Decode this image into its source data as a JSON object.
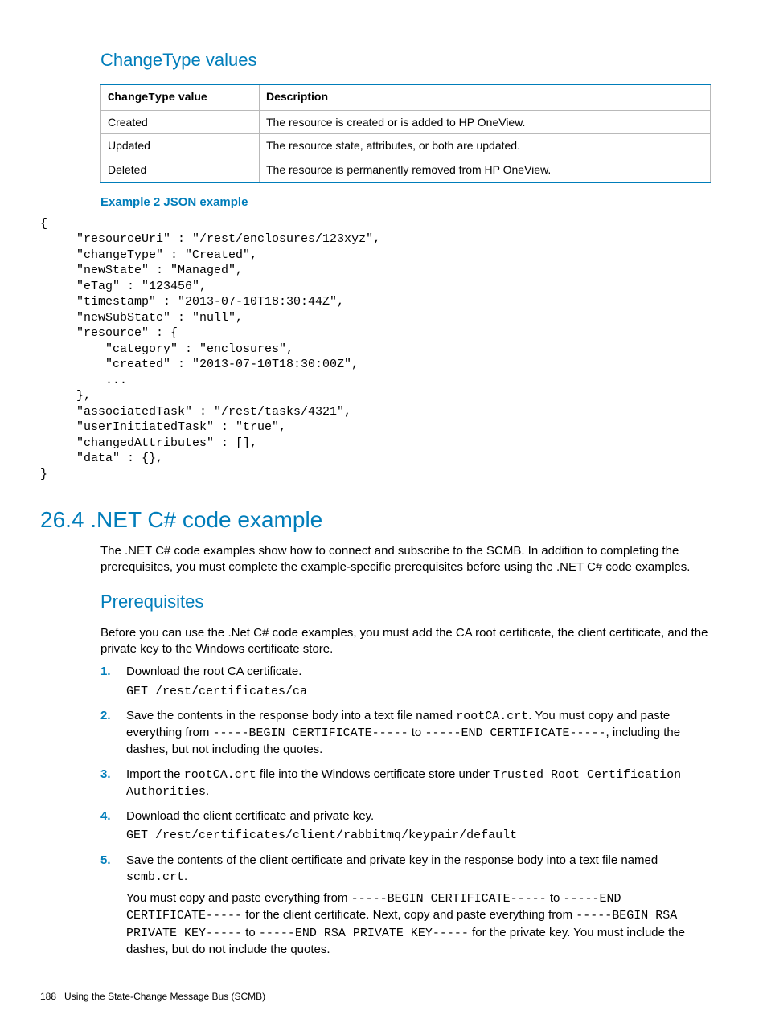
{
  "headings": {
    "changetype": "ChangeType values",
    "net_example": "26.4 .NET C# code example",
    "prerequisites": "Prerequisites",
    "example_label": "Example 2 JSON example"
  },
  "table": {
    "header_col1_mono": "ChangeType",
    "header_col1_rest": " value",
    "header_col2": "Description",
    "rows": [
      {
        "value": "Created",
        "desc": "The resource is created or is added to HP OneView."
      },
      {
        "value": "Updated",
        "desc": "The resource state, attributes, or both are updated."
      },
      {
        "value": "Deleted",
        "desc": "The resource is permanently removed from HP OneView."
      }
    ]
  },
  "json_code": "{\n     \"resourceUri\" : \"/rest/enclosures/123xyz\",\n     \"changeType\" : \"Created\",\n     \"newState\" : \"Managed\",\n     \"eTag\" : \"123456\",\n     \"timestamp\" : \"2013-07-10T18:30:44Z\",\n     \"newSubState\" : \"null\",\n     \"resource\" : {\n         \"category\" : \"enclosures\",\n         \"created\" : \"2013-07-10T18:30:00Z\",\n         ...\n     },\n     \"associatedTask\" : \"/rest/tasks/4321\",\n     \"userInitiatedTask\" : \"true\",\n     \"changedAttributes\" : [],\n     \"data\" : {},\n}",
  "net_intro": "The .NET C# code examples show how to connect and subscribe to the SCMB. In addition to completing the prerequisites, you must complete the example-specific prerequisites before using the .NET C# code examples.",
  "prereq_intro": "Before you can use the .Net C# code examples, you must add the CA root certificate, the client certificate, and the private key to the Windows certificate store.",
  "steps": {
    "s1_text": "Download the root CA certificate.",
    "s1_code": "GET /rest/certificates/ca",
    "s2_a": "Save the contents in the response body into a text file named ",
    "s2_rootca": "rootCA.crt",
    "s2_b": ". You must copy and paste everything from ",
    "s2_begin": "-----BEGIN CERTIFICATE-----",
    "s2_c": " to ",
    "s2_end": "-----END CERTIFICATE-----",
    "s2_d": ", including the dashes, but not including the quotes.",
    "s3_a": "Import the ",
    "s3_file": "rootCA.crt",
    "s3_b": " file into the Windows certificate store under ",
    "s3_store": "Trusted Root Certification Authorities",
    "s3_c": ".",
    "s4_text": "Download the client certificate and private key.",
    "s4_code": "GET /rest/certificates/client/rabbitmq/keypair/default",
    "s5_a": "Save the contents of the client certificate and private key in the response body into a text file named ",
    "s5_file": "scmb.crt",
    "s5_b": ".",
    "s5_p2_a": "You must copy and paste everything from ",
    "s5_begin_cert": "-----BEGIN CERTIFICATE-----",
    "s5_p2_b": " to ",
    "s5_end_cert": "-----END CERTIFICATE-----",
    "s5_p2_c": " for the client certificate. Next, copy and paste everything from ",
    "s5_begin_key": "-----BEGIN RSA PRIVATE KEY-----",
    "s5_p2_d": " to ",
    "s5_end_key": "-----END RSA PRIVATE KEY-----",
    "s5_p2_e": " for the private key. You must include the dashes, but do not include the quotes."
  },
  "footer": {
    "page": "188",
    "title": "Using the State-Change Message Bus (SCMB)"
  }
}
